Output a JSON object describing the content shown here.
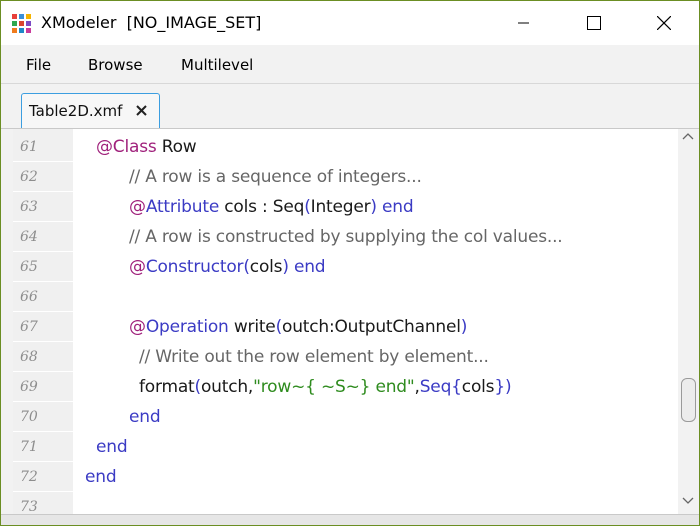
{
  "window": {
    "title": "XModeler  [NO_IMAGE_SET]",
    "icon_colors": [
      "#e8403a",
      "#3a8fd8",
      "#f5b400",
      "#2fa84f",
      "#d9442f",
      "#7b4bc4",
      "#f07c1e",
      "#1e88c8",
      "#c93a9b"
    ]
  },
  "menu": {
    "items": [
      {
        "label": "File"
      },
      {
        "label": "Browse"
      },
      {
        "label": "Multilevel"
      }
    ]
  },
  "tabs": [
    {
      "label": "Table2D.xmf"
    }
  ],
  "editor": {
    "lines": [
      {
        "num": "61",
        "indent": 95,
        "tokens": [
          {
            "t": "@Class",
            "c": "kw"
          },
          {
            "t": " Row",
            "c": "plain"
          }
        ]
      },
      {
        "num": "62",
        "indent": 128,
        "tokens": [
          {
            "t": "// A row is a sequence of integers...",
            "c": "cm"
          }
        ]
      },
      {
        "num": "63",
        "indent": 128,
        "tokens": [
          {
            "t": "@",
            "c": "kw"
          },
          {
            "t": "Attribute",
            "c": "kw2"
          },
          {
            "t": " cols : Seq",
            "c": "plain"
          },
          {
            "t": "(",
            "c": "kw2"
          },
          {
            "t": "Integer",
            "c": "plain"
          },
          {
            "t": ")",
            "c": "kw2"
          },
          {
            "t": " end",
            "c": "kw2"
          }
        ]
      },
      {
        "num": "64",
        "indent": 128,
        "tokens": [
          {
            "t": "// A row is constructed by supplying the col values...",
            "c": "cm"
          }
        ]
      },
      {
        "num": "65",
        "indent": 128,
        "tokens": [
          {
            "t": "@",
            "c": "kw"
          },
          {
            "t": "Constructor",
            "c": "kw2"
          },
          {
            "t": "(",
            "c": "kw2"
          },
          {
            "t": "cols",
            "c": "plain"
          },
          {
            "t": ")",
            "c": "kw2"
          },
          {
            "t": " end",
            "c": "kw2"
          }
        ]
      },
      {
        "num": "66",
        "indent": 128,
        "tokens": []
      },
      {
        "num": "67",
        "indent": 128,
        "tokens": [
          {
            "t": "@",
            "c": "kw"
          },
          {
            "t": "Operation",
            "c": "kw2"
          },
          {
            "t": " write",
            "c": "plain"
          },
          {
            "t": "(",
            "c": "kw2"
          },
          {
            "t": "outch:OutputChannel",
            "c": "plain"
          },
          {
            "t": ")",
            "c": "kw2"
          }
        ]
      },
      {
        "num": "68",
        "indent": 138,
        "tokens": [
          {
            "t": "// Write out the row element by element...",
            "c": "cm"
          }
        ]
      },
      {
        "num": "69",
        "indent": 138,
        "tokens": [
          {
            "t": "format",
            "c": "plain"
          },
          {
            "t": "(",
            "c": "kw2"
          },
          {
            "t": "outch,",
            "c": "plain"
          },
          {
            "t": "\"row~{ ~S~} end\"",
            "c": "str"
          },
          {
            "t": ",",
            "c": "plain"
          },
          {
            "t": "Seq",
            "c": "kw2"
          },
          {
            "t": "{",
            "c": "kw2"
          },
          {
            "t": "cols",
            "c": "plain"
          },
          {
            "t": "}",
            "c": "kw2"
          },
          {
            "t": ")",
            "c": "kw2"
          }
        ]
      },
      {
        "num": "70",
        "indent": 128,
        "tokens": [
          {
            "t": "end",
            "c": "kw2"
          }
        ]
      },
      {
        "num": "71",
        "indent": 95,
        "tokens": [
          {
            "t": "end",
            "c": "kw2"
          }
        ]
      },
      {
        "num": "72",
        "indent": 84,
        "tokens": [
          {
            "t": "end",
            "c": "kw2"
          }
        ]
      },
      {
        "num": "73",
        "indent": 84,
        "tokens": []
      }
    ]
  },
  "scrollbar": {
    "position_fraction": 0.72
  }
}
